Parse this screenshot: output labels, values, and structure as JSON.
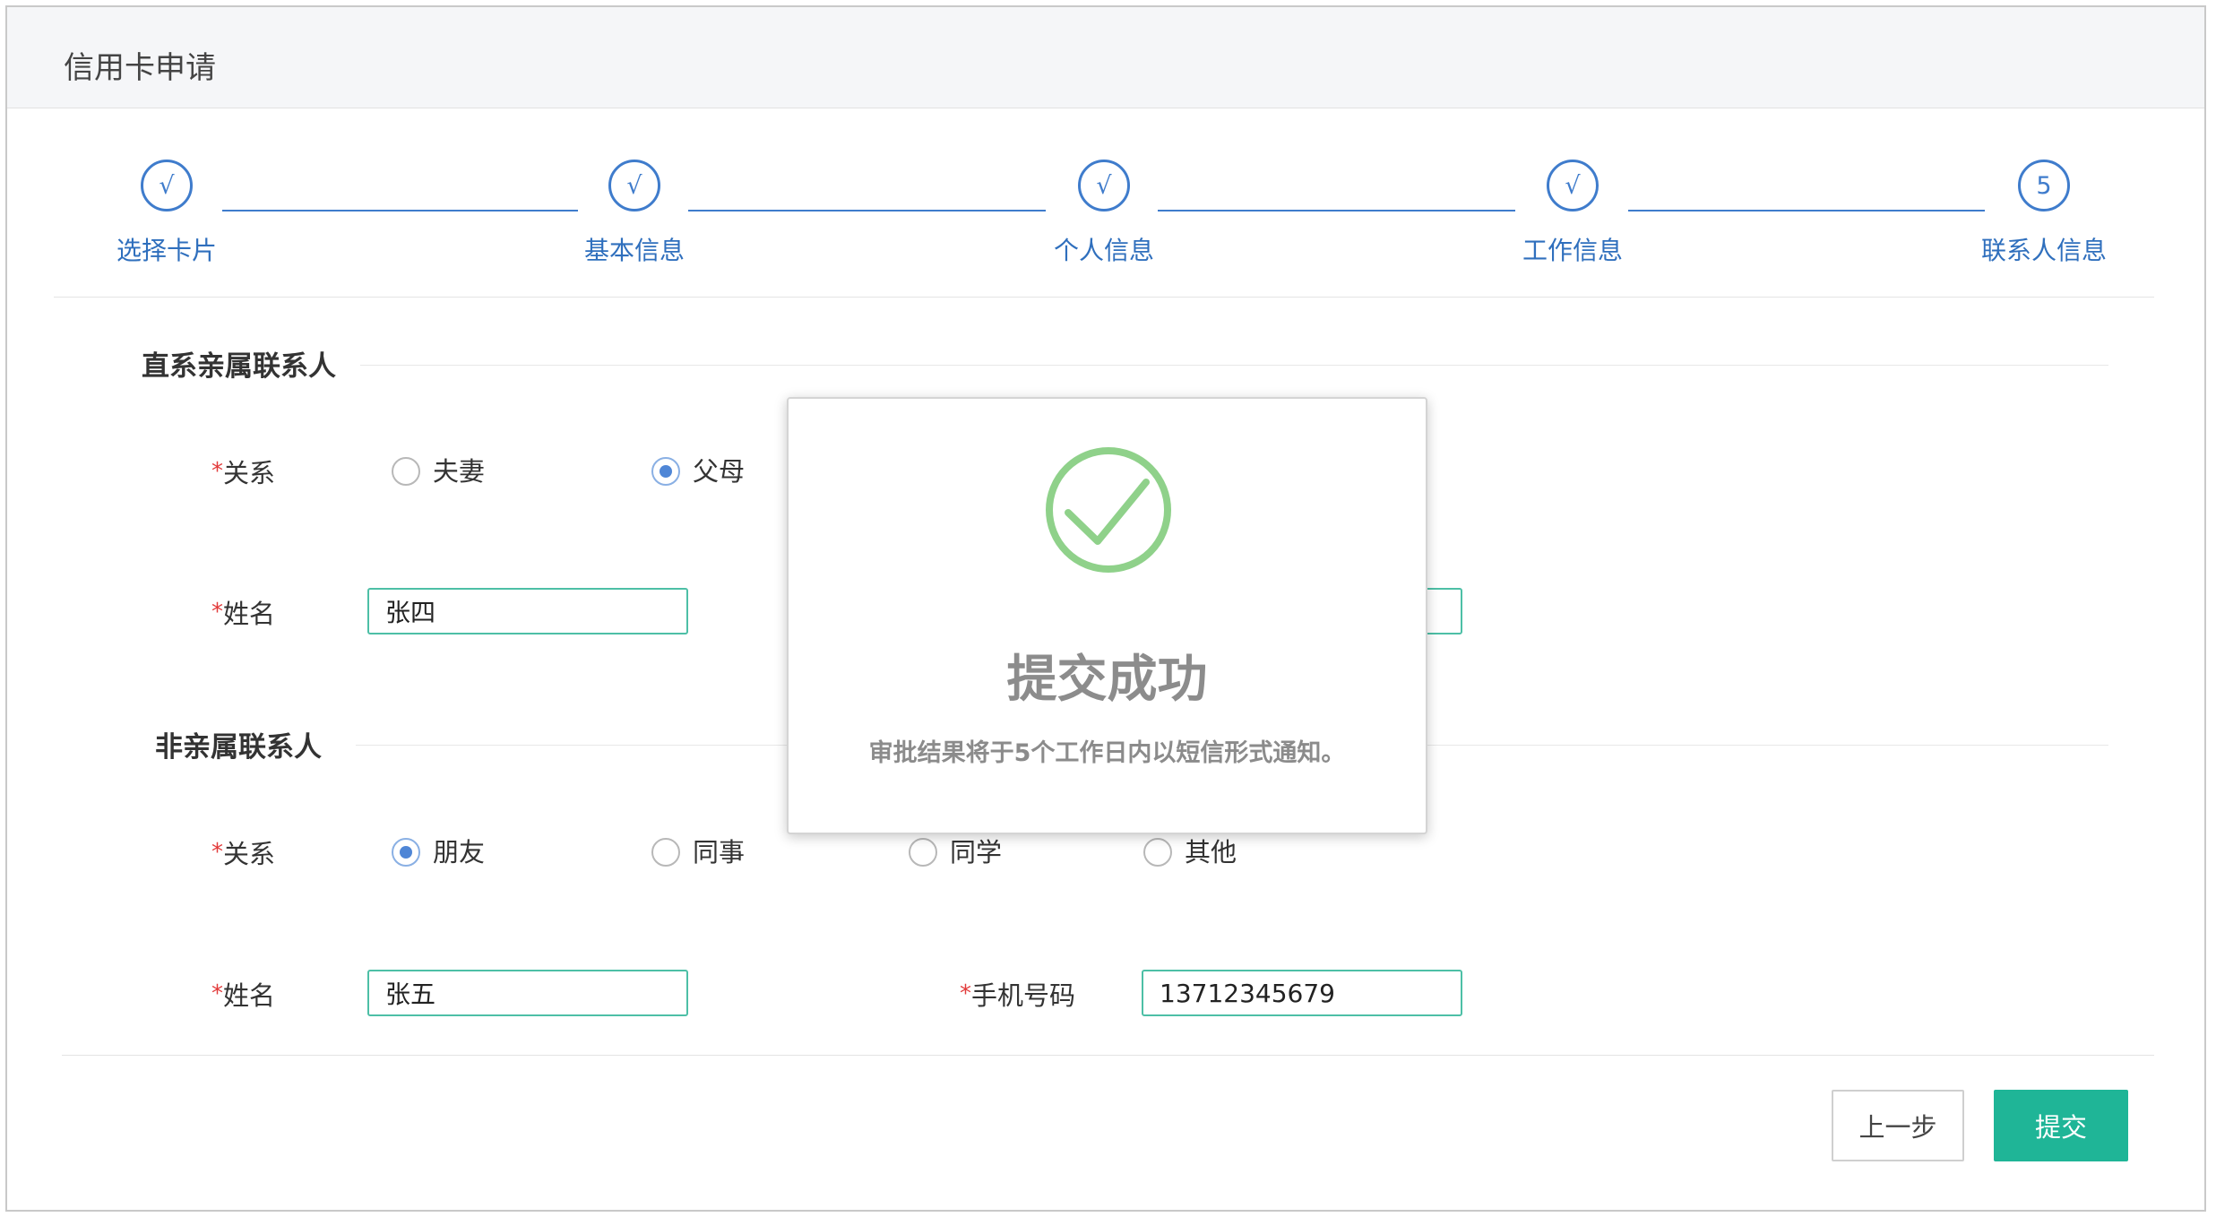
{
  "window": {
    "title": "信用卡申请"
  },
  "colors": {
    "accent": "#3f7ccc",
    "submit": "#1fb597",
    "input_border": "#4dbfa6",
    "success": "#8fd18a",
    "required": "#e23b3b"
  },
  "steps": [
    {
      "marker": "√",
      "label": "选择卡片"
    },
    {
      "marker": "√",
      "label": "基本信息"
    },
    {
      "marker": "√",
      "label": "个人信息"
    },
    {
      "marker": "√",
      "label": "工作信息"
    },
    {
      "marker": "5",
      "label": "联系人信息"
    }
  ],
  "form": {
    "required_mark": "*"
  },
  "direct": {
    "title": "直系亲属联系人",
    "relation": {
      "label": "关系",
      "options": [
        {
          "label": "夫妻",
          "checked": false
        },
        {
          "label": "父母",
          "checked": true
        }
      ]
    },
    "name": {
      "label": "姓名",
      "value": "张四"
    }
  },
  "non_relative": {
    "title": "非亲属联系人",
    "relation": {
      "label": "关系",
      "options": [
        {
          "label": "朋友",
          "checked": true
        },
        {
          "label": "同事",
          "checked": false
        },
        {
          "label": "同学",
          "checked": false
        },
        {
          "label": "其他",
          "checked": false
        }
      ]
    },
    "name": {
      "label": "姓名",
      "value": "张五"
    },
    "phone": {
      "label": "手机号码",
      "value": "13712345679"
    }
  },
  "buttons": {
    "prev": "上一步",
    "submit": "提交"
  },
  "modal": {
    "icon": "check-circle-icon",
    "title": "提交成功",
    "message": "审批结果将于5个工作日内以短信形式通知。"
  }
}
